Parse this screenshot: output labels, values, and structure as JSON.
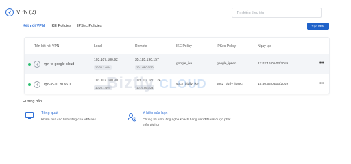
{
  "header": {
    "title": "VPN (2)",
    "search_placeholder": "Tìm kiếm theo tên"
  },
  "tabs": [
    {
      "label": "Kết nối VPN",
      "active": true
    },
    {
      "label": "IKE Policies",
      "active": false
    },
    {
      "label": "IPSec Policies",
      "active": false
    }
  ],
  "create_button": "Tạo VPN",
  "table": {
    "columns": [
      "Tên kết nối VPN",
      "Local",
      "Remote",
      "IKE Policy",
      "IPSec Policy",
      "Ngày tạo"
    ],
    "rows": [
      {
        "name": "vpn-to-google-cloud",
        "local_ip": "103.107.180.92",
        "local_subnet": "10.20.1.0/24",
        "remote_ip": "35.185.190.157",
        "remote_subnet": "10.148.0.0/20",
        "ike_policy": "google_ike",
        "ipsec_policy": "google_ipsec",
        "created": "17:02:16 05/03/2019",
        "status_color": "#2fbf71"
      },
      {
        "name": "vpn-to-10.20.66.0",
        "local_ip": "103.107.180.90",
        "local_subnet": "10.20.1.0/24",
        "remote_ip": "103.107.180.124",
        "remote_subnet": "10.20.66.0/24",
        "ike_policy": "vpc2_bizfly_ike",
        "ipsec_policy": "vpc2_bizfly_ipsec",
        "created": "15:50:55 05/03/2019",
        "status_color": "#2fbf71"
      }
    ]
  },
  "guide": {
    "title": "Hướng dẫn",
    "items": [
      {
        "label": "Tổng quát",
        "desc": "Khám phá các tính năng của VPNaas"
      },
      {
        "label": "Ý kiến của bạn",
        "desc": "Chúng tôi luôn lắng nghe khách hàng để VPNaas được phát triển tốt hơn"
      }
    ]
  },
  "watermark": {
    "brand": "Bizfly",
    "suffix": "CLOUD"
  },
  "colors": {
    "accent": "#2f6fd6",
    "button": "#1f62c9",
    "status": "#2fbf71"
  }
}
